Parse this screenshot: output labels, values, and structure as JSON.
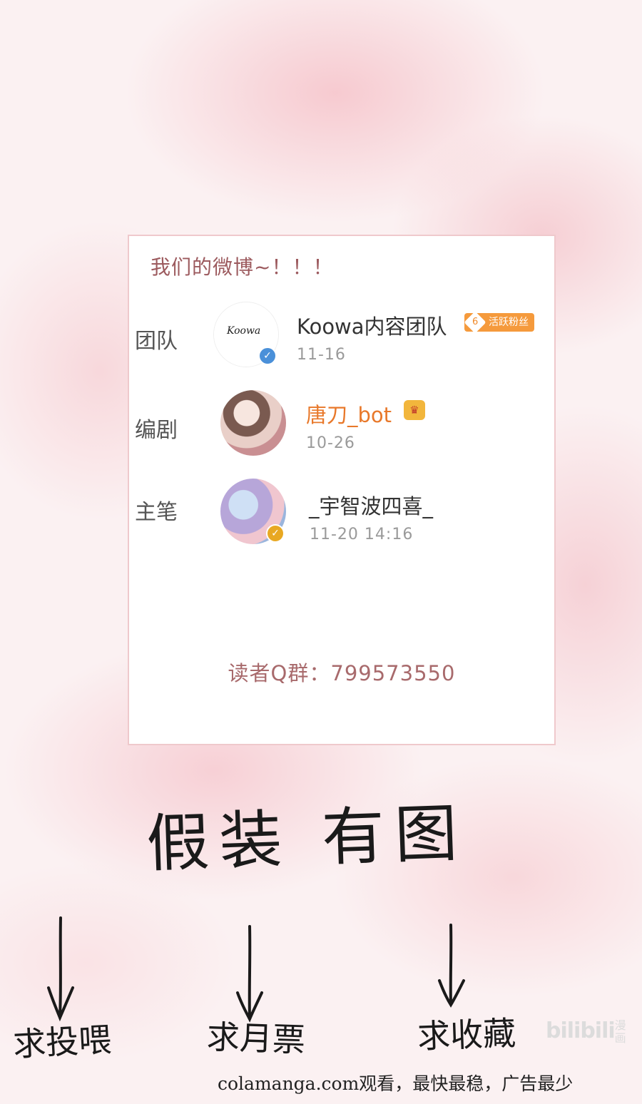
{
  "card": {
    "title": "我们的微博~！！！",
    "rows": [
      {
        "role": "团队",
        "name": "Koowa内容团队",
        "date": "11-16",
        "badge": "活跃粉丝",
        "badge_level": "6",
        "avatar_text": "Koowa"
      },
      {
        "role": "编剧",
        "name": "唐刀_bot",
        "date": "10-26"
      },
      {
        "role": "主笔",
        "name": "_宇智波四喜_",
        "date": "11-20 14:16"
      }
    ],
    "qq_group": "读者Q群：799573550"
  },
  "handwriting": {
    "title": "假装 有图",
    "labels": [
      "求投喂",
      "求月票",
      "求收藏"
    ]
  },
  "logo": {
    "text": "bilibili",
    "sub": "漫画"
  },
  "footer": {
    "watermark": "colamanga.com观看，最快最稳，广告最少"
  },
  "colors": {
    "accent_orange": "#f59a3c",
    "verified_blue": "#4a90d9",
    "verified_gold": "#e8a822",
    "name_orange": "#e8782a",
    "card_border": "#efc9cc"
  }
}
